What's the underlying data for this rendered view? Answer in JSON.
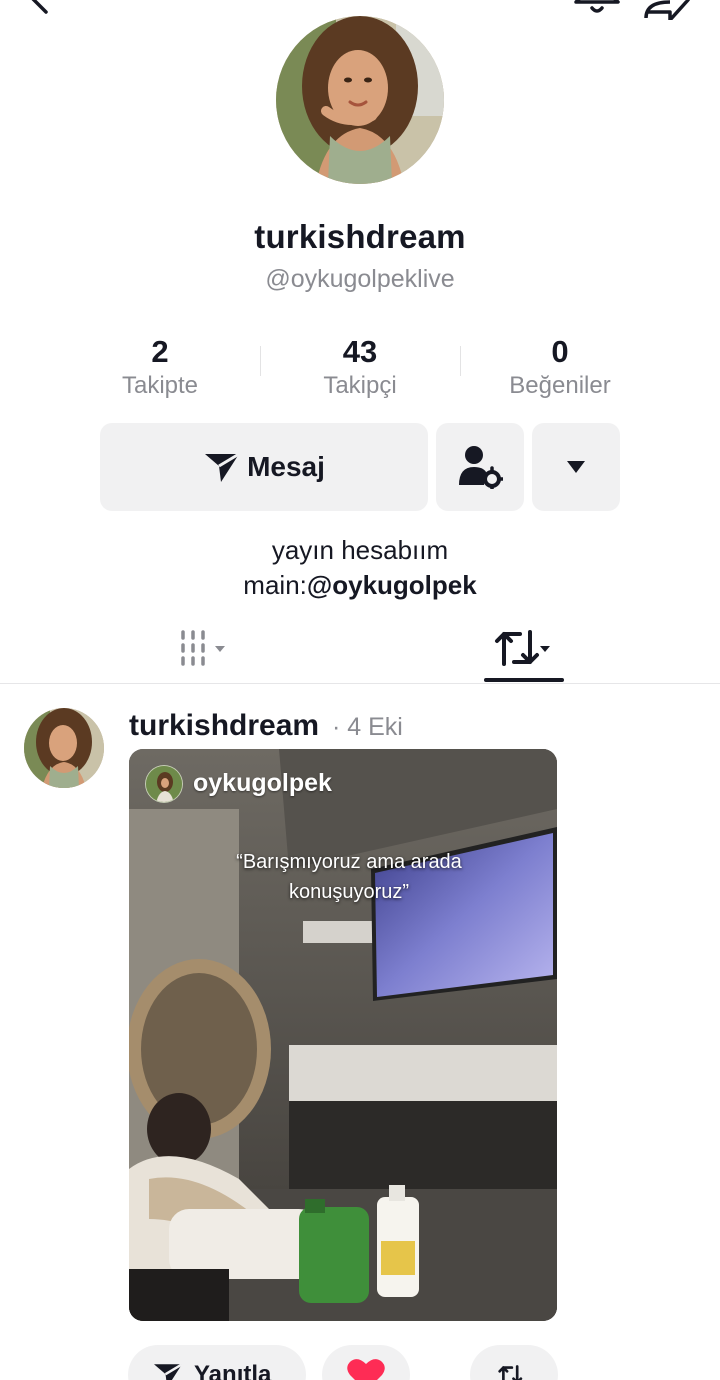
{
  "profile": {
    "display_name": "turkishdream",
    "handle": "@oykugolpeklive"
  },
  "stats": [
    {
      "value": "2",
      "label": "Takipte"
    },
    {
      "value": "43",
      "label": "Takipçi"
    },
    {
      "value": "0",
      "label": "Beğeniler"
    }
  ],
  "actions": {
    "message_label": "Mesaj"
  },
  "bio": {
    "line1": "yayın hesabıım",
    "line2_prefix": "main:",
    "line2_mention": "@oykugolpek"
  },
  "post": {
    "author": "turkishdream",
    "date": "· 4 Eki",
    "video_user": "oykugolpek",
    "caption_line1": "“Barışmıyoruz ama arada",
    "caption_line2": "konuşuyoruz”",
    "reply_label": "Yanıtla"
  },
  "colors": {
    "text": "#161823",
    "muted": "#8a8b91",
    "button_bg": "#f1f1f2",
    "like_red": "#fe2c55"
  },
  "icons": [
    "back-icon",
    "bell-icon",
    "share-icon",
    "send-icon",
    "user-settings-icon",
    "caret-down-icon",
    "grid-icon",
    "repost-icon",
    "heart-icon"
  ]
}
